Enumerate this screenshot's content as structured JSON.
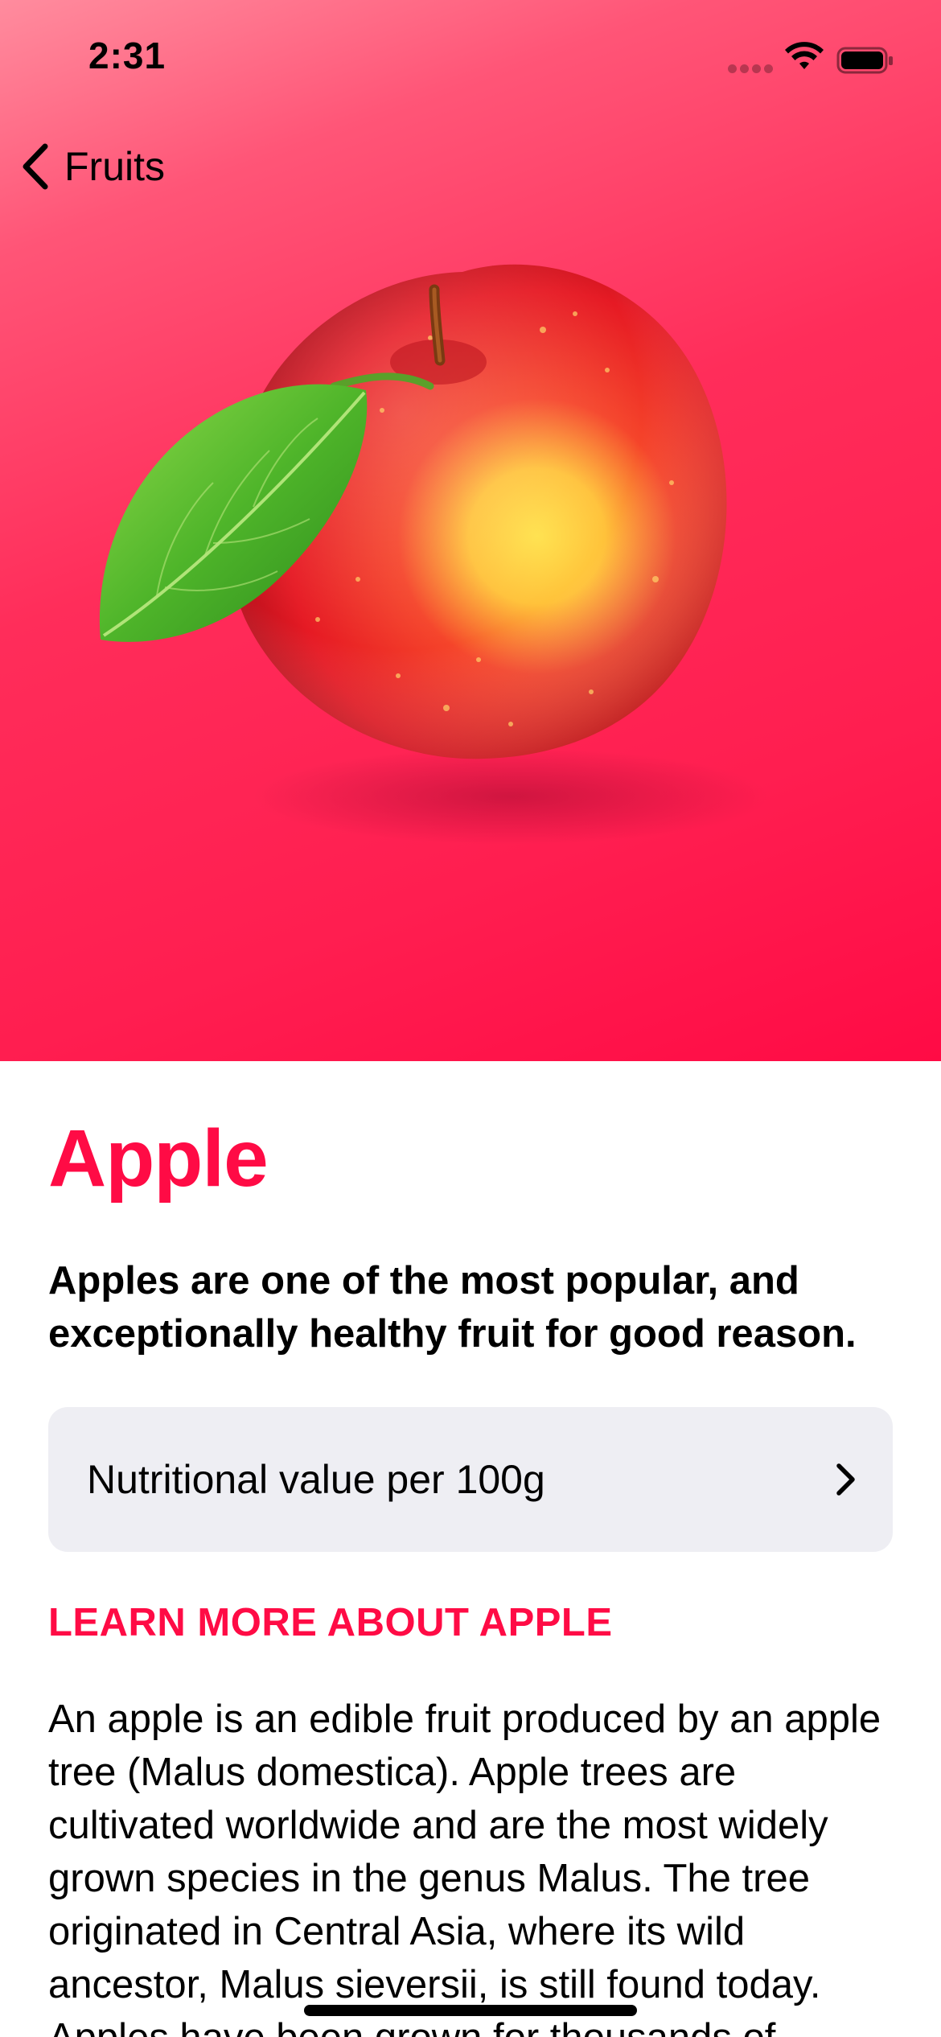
{
  "status_bar": {
    "time": "2:31"
  },
  "navigation": {
    "back_label": "Fruits",
    "back_icon": "chevron-left-icon"
  },
  "hero": {
    "image": "apple-illustration",
    "gradient_colors": [
      "#ff8c9e",
      "#ff0b45"
    ]
  },
  "fruit": {
    "title": "Apple",
    "headline": "Apples are one of the most popular, and exceptionally healthy fruit for good reason.",
    "nutrition_row_label": "Nutritional value per 100g",
    "nutrition_row_icon": "chevron-right-icon",
    "section_header": "LEARN MORE ABOUT APPLE",
    "description": "An apple is an edible fruit produced by an apple tree (Malus domestica). Apple trees are cultivated worldwide and are the most widely grown species in the genus Malus. The tree originated in Central Asia, where its wild ancestor, Malus sieversii, is still found today. Apples have been grown for thousands of"
  },
  "colors": {
    "accent": "#ff0b45",
    "row_background": "#eeeef3",
    "text": "#000000"
  }
}
